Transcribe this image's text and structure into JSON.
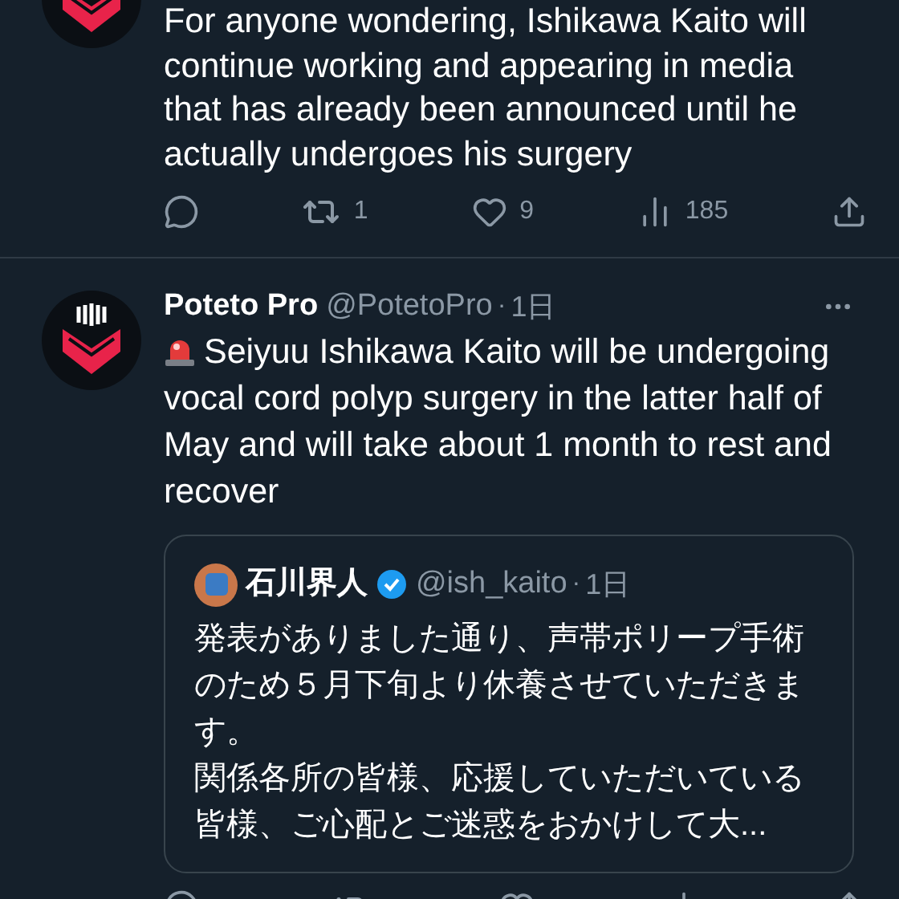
{
  "tweets": [
    {
      "kind": "continued",
      "text": "For anyone wondering, Ishikawa Kaito will continue working and appearing in media that has already been announced until he actually undergoes his surgery",
      "actions": {
        "retweets": "1",
        "likes": "9",
        "views": "185"
      }
    },
    {
      "kind": "full",
      "name": "Poteto Pro",
      "handle": "@PotetoPro",
      "separator": "·",
      "time": "1日",
      "text": "Seiyuu Ishikawa Kaito will be undergoing vocal cord polyp surgery in the latter half of May and will take about 1 month to rest and recover",
      "quote": {
        "name": "石川界人",
        "verified": true,
        "handle": "@ish_kaito",
        "separator": "·",
        "time": "1日",
        "paragraphs": [
          "発表がありました通り、声帯ポリープ手術のため５月下旬より休養させていただきます。",
          "関係各所の皆様、応援していただいている皆様、ご心配とご迷惑をおかけして大..."
        ]
      }
    }
  ]
}
